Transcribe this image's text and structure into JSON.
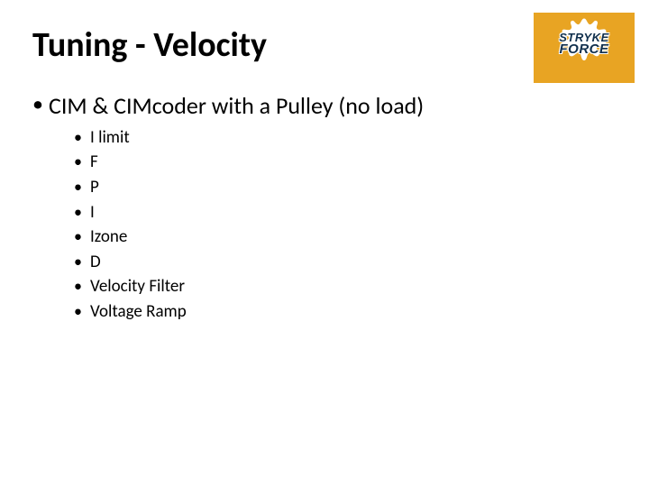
{
  "title": "Tuning - Velocity",
  "level1_item": "CIM & CIMcoder with a Pulley (no load)",
  "sub_items": [
    "I limit",
    "F",
    "P",
    "I",
    "Izone",
    "D",
    "Velocity Filter",
    "Voltage Ramp"
  ],
  "logo": {
    "line1": "STRYKE",
    "line2": "FORCE",
    "bg_color": "#e8a423",
    "splat_color": "#ffffff",
    "text_color": "#11304d"
  }
}
